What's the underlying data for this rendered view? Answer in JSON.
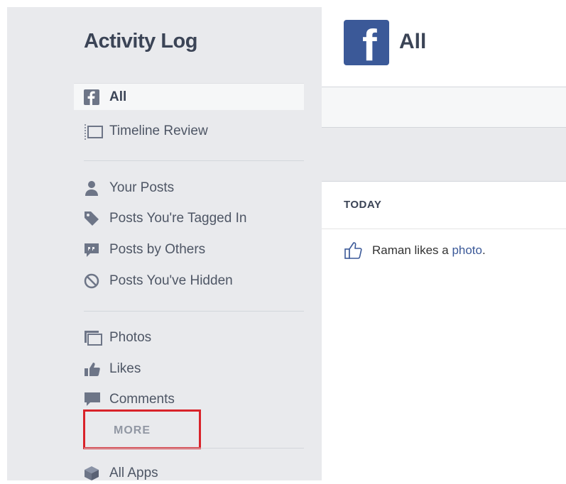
{
  "sidebar": {
    "title": "Activity Log",
    "groups": [
      [
        {
          "label": "All",
          "icon": "facebook-icon",
          "active": true
        },
        {
          "label": "Timeline Review",
          "icon": "timeline-review-icon"
        }
      ],
      [
        {
          "label": "Your Posts",
          "icon": "person-icon"
        },
        {
          "label": "Posts You're Tagged In",
          "icon": "tag-icon"
        },
        {
          "label": "Posts by Others",
          "icon": "speech-bubble-icon"
        },
        {
          "label": "Posts You've Hidden",
          "icon": "hidden-icon"
        }
      ],
      [
        {
          "label": "Photos",
          "icon": "photos-icon"
        },
        {
          "label": "Likes",
          "icon": "thumbs-up-icon"
        },
        {
          "label": "Comments",
          "icon": "comment-icon"
        }
      ]
    ],
    "more_label": "MORE",
    "apps_label": "All Apps"
  },
  "main": {
    "title": "All",
    "logo_letter": "f",
    "section_heading": "TODAY",
    "activity": {
      "prefix": "Raman likes a ",
      "link": "photo",
      "suffix": "."
    }
  },
  "colors": {
    "brand": "#3b5998",
    "highlight": "#d9232a",
    "sidebar_bg": "#e9eaed"
  }
}
